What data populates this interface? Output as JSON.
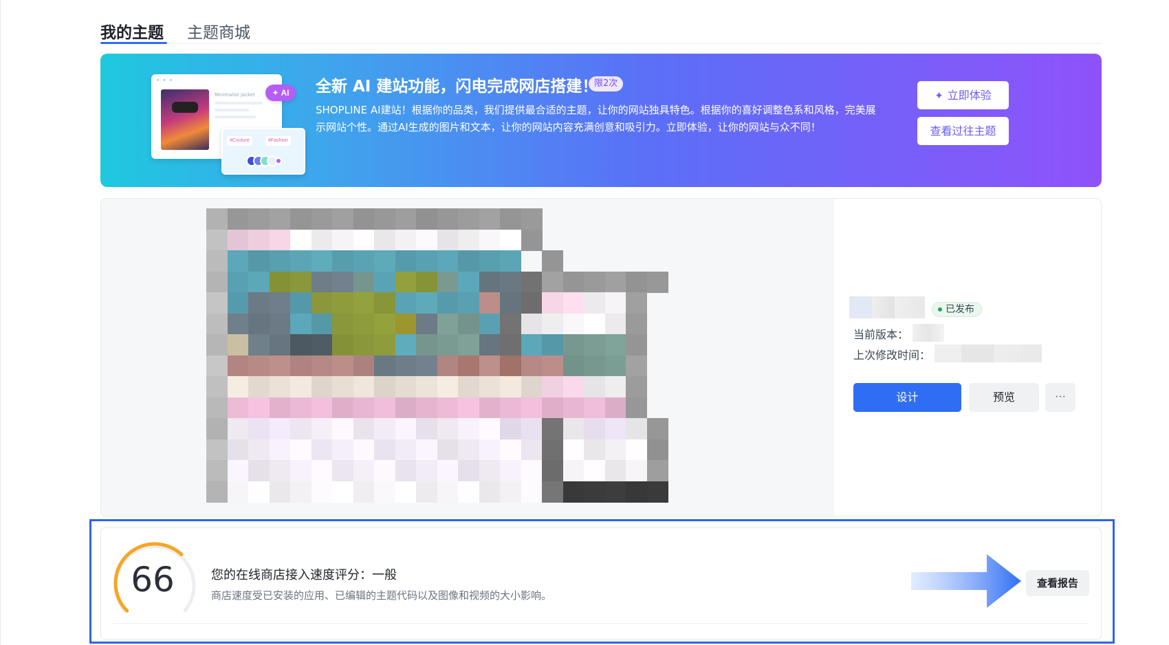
{
  "tabs": {
    "mine": "我的主题",
    "store": "主题商城"
  },
  "banner": {
    "title": "全新 AI 建站功能，闪电完成网店搭建！",
    "limit_badge": "限2次",
    "description": "SHOPLINE AI建站！根据你的品类，我们提供最合适的主题，让你的网站独具特色。根据你的喜好调整色系和风格，完美展示网站个性。通过AI生成的图片和文本，让你的网站内容充满创意和吸引力。立即体验，让你的网站与众不同！",
    "try_button": "立即体验",
    "past_button": "查看过往主题",
    "illustration": {
      "ai_badge": "AI",
      "product_text": "Minimalist jacket",
      "chip_1": "#Couture",
      "chip_2": "#Fashion"
    },
    "colors": {
      "start": "#1fc8df",
      "end": "#8f52fb"
    }
  },
  "theme": {
    "status_badge": "已发布",
    "version_label": "当前版本：",
    "modified_label": "上次修改时间：",
    "design_button": "设计",
    "preview_button": "预览",
    "more_button": "···",
    "thumbnail": "pixelated-theme-preview"
  },
  "speed": {
    "score": "66",
    "score_value": 66,
    "title": "您的在线商店接入速度评分：一般",
    "description": "商店速度受已安装的应用、已编辑的主题代码以及图像和视频的大小影响。",
    "report_button": "查看报告",
    "gauge_color": "#f5a623"
  },
  "colors": {
    "primary": "#2f6ef4",
    "highlight_border": "#2f62e8",
    "published": "#25a35a"
  },
  "icons": {
    "try": "sparkle-icon",
    "more": "ellipsis-icon",
    "arrow": "arrow-right-icon"
  }
}
